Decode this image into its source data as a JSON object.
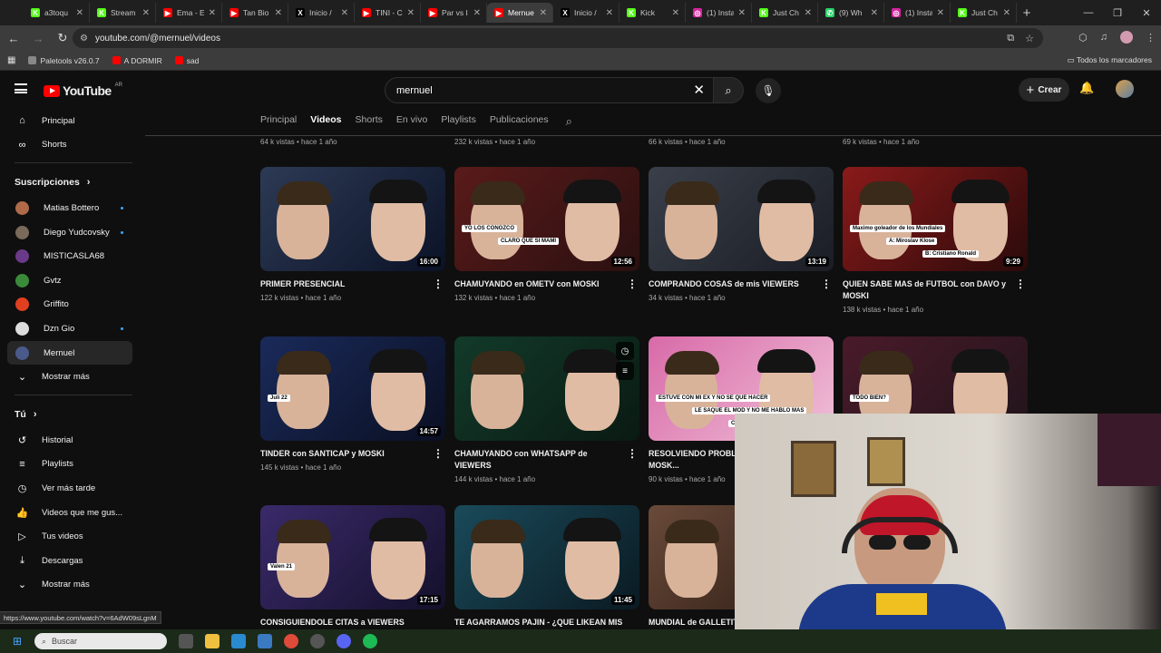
{
  "browser": {
    "tabs": [
      {
        "title": "a3toqu",
        "color": "#53fc18",
        "glyph": "K"
      },
      {
        "title": "Stream",
        "color": "#53fc18",
        "glyph": "K"
      },
      {
        "title": "Ema - E",
        "color": "#ff0000",
        "glyph": "▶"
      },
      {
        "title": "Tan Bio",
        "color": "#ff0000",
        "glyph": "▶"
      },
      {
        "title": "Inicio /",
        "color": "#000000",
        "glyph": "X"
      },
      {
        "title": "TINI - C",
        "color": "#ff0000",
        "glyph": "▶"
      },
      {
        "title": "Par vs I",
        "color": "#ff0000",
        "glyph": "▶"
      },
      {
        "title": "Mernue",
        "color": "#ff0000",
        "glyph": "▶",
        "active": true
      },
      {
        "title": "Inicio /",
        "color": "#000000",
        "glyph": "X"
      },
      {
        "title": "Kick",
        "color": "#53fc18",
        "glyph": "K"
      },
      {
        "title": "(1) Insta",
        "color": "#d6249f",
        "glyph": "◎"
      },
      {
        "title": "Just Ch",
        "color": "#53fc18",
        "glyph": "K"
      },
      {
        "title": "(9) Wh",
        "color": "#25d366",
        "glyph": "✆"
      },
      {
        "title": "(1) Insta",
        "color": "#d6249f",
        "glyph": "◎"
      },
      {
        "title": "Just Ch",
        "color": "#53fc18",
        "glyph": "K"
      }
    ],
    "url": "youtube.com/@mernuel/videos",
    "bookmarks": [
      {
        "label": "Paletools v26.0.7",
        "color": "#888888"
      },
      {
        "label": "A DORMIR",
        "color": "#ff0000"
      },
      {
        "label": "sad",
        "color": "#ff0000"
      }
    ],
    "all_bookmarks": "Todos los marcadores",
    "status_url": "https://www.youtube.com/watch?v=6AdW09sLgnM"
  },
  "youtube": {
    "logo": "YouTube",
    "region": "AR",
    "search_value": "mernuel",
    "create_label": "Crear",
    "sidebar": {
      "main": [
        {
          "label": "Principal",
          "icon": "⌂"
        },
        {
          "label": "Shorts",
          "icon": "∞"
        }
      ],
      "subs_title": "Suscripciones",
      "subs": [
        {
          "label": "Matias Bottero",
          "color": "#b06a4a",
          "live": true
        },
        {
          "label": "Diego Yudcovsky",
          "color": "#7a6a5a",
          "live": true
        },
        {
          "label": "MISTICASLA68",
          "color": "#6a3a8a",
          "live": false
        },
        {
          "label": "Gvtz",
          "color": "#3a8a3a",
          "live": false
        },
        {
          "label": "Griffito",
          "color": "#e04020",
          "live": false
        },
        {
          "label": "Dzn Gio",
          "color": "#dddddd",
          "live": true
        },
        {
          "label": "Mernuel",
          "color": "#4a5a8a",
          "live": false,
          "selected": true
        }
      ],
      "more1": "Mostrar más",
      "you_title": "Tú",
      "you": [
        {
          "label": "Historial",
          "icon": "↺"
        },
        {
          "label": "Playlists",
          "icon": "≡"
        },
        {
          "label": "Ver más tarde",
          "icon": "◷"
        },
        {
          "label": "Videos que me gus...",
          "icon": "👍"
        },
        {
          "label": "Tus videos",
          "icon": "▷"
        },
        {
          "label": "Descargas",
          "icon": "⤓"
        }
      ],
      "more2": "Mostrar más"
    },
    "channel_tabs": [
      "Principal",
      "Videos",
      "Shorts",
      "En vivo",
      "Playlists",
      "Publicaciones"
    ],
    "active_tab": "Videos",
    "top_meta": [
      "64 k vistas • hace 1 año",
      "232 k vistas • hace 1 año",
      "66 k vistas • hace 1 año",
      "69 k vistas • hace 1 año"
    ],
    "videos": [
      {
        "title": "PRIMER PRESENCIAL",
        "meta": "122 k vistas • hace 1 año",
        "duration": "16:00",
        "bg": "#2d3a55",
        "bg2": "#0a1226"
      },
      {
        "title": "CHAMUYANDO en OMETV con MOSKI",
        "meta": "132 k vistas • hace 1 año",
        "duration": "12:56",
        "bg": "#5a1a1a",
        "bg2": "#2a1010",
        "labels": [
          "YO LOS CONOZCO",
          "CLARO QUE SI MAMI"
        ]
      },
      {
        "title": "COMPRANDO COSAS de mis VIEWERS",
        "meta": "34 k vistas • hace 1 año",
        "duration": "13:19",
        "bg": "#3a3f4a",
        "bg2": "#1a1d24"
      },
      {
        "title": "QUIEN SABE MAS de FUTBOL con DAVO y MOSKI",
        "meta": "138 k vistas • hace 1 año",
        "duration": "9:29",
        "bg": "#8a1a1a",
        "bg2": "#2a0a0a",
        "labels": [
          "Maximo goleador de los Mundiales",
          "A: Miroslav Klose",
          "B: Cristiano Ronald"
        ]
      },
      {
        "title": "TINDER con SANTICAP y MOSKI",
        "meta": "145 k vistas • hace 1 año",
        "duration": "14:57",
        "bg": "#1a2a5a",
        "bg2": "#0a0f22",
        "labels": [
          "Juli 22"
        ]
      },
      {
        "title": "CHAMUYANDO con WHATSAPP de VIEWERS",
        "meta": "144 k vistas • hace 1 año",
        "duration": "",
        "bg": "#123a2a",
        "bg2": "#0a1a12"
      },
      {
        "title": "RESOLVIENDO PROBLE... VIEWERS #3 con MOSK...",
        "meta": "90 k vistas • hace 1 año",
        "duration": "",
        "bg": "#d86aa8",
        "bg2": "#f0c0d8",
        "labels": [
          "ESTUVE CON MI EX Y NO SE QUE HACER",
          "LE SAQUE EL MOD Y NO ME HABLO MAS",
          "Consultorio"
        ]
      },
      {
        "title": "",
        "meta": "",
        "duration": "",
        "bg": "#4a1a2a",
        "bg2": "#20141a",
        "labels": [
          "TODO BIEN?"
        ]
      },
      {
        "title": "CONSIGUIENDOLE CITAS a VIEWERS",
        "meta": "",
        "duration": "17:15",
        "bg": "#3a2a6a",
        "bg2": "#14102a",
        "labels": [
          "Valen 21"
        ]
      },
      {
        "title": "TE AGARRAMOS PAJIN - ¿QUE LIKEAN MIS ...",
        "meta": "",
        "duration": "11:45",
        "bg": "#1a4a5a",
        "bg2": "#0a1a22"
      },
      {
        "title": "MUNDIAL de GALLETIT...",
        "meta": "",
        "duration": "",
        "bg": "#6a4a3a",
        "bg2": "#2a1a12"
      }
    ]
  },
  "taskbar": {
    "search_label": "Buscar"
  }
}
